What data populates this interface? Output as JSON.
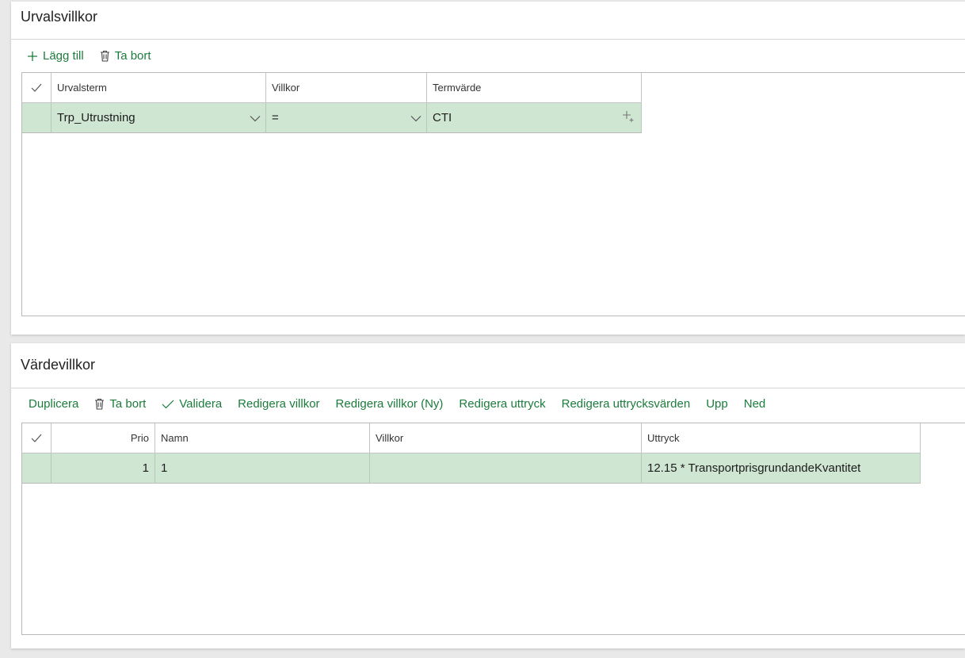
{
  "selection": {
    "title": "Urvalsvillkor",
    "toolbar": {
      "add_label": "Lägg till",
      "delete_label": "Ta bort"
    },
    "grid": {
      "headers": {
        "term": "Urvalsterm",
        "condition": "Villkor",
        "value": "Termvärde"
      },
      "rows": [
        {
          "term": "Trp_Utrustning",
          "condition": "=",
          "value": "CTI"
        }
      ]
    }
  },
  "value_conditions": {
    "title": "Värdevillkor",
    "toolbar": {
      "duplicate_label": "Duplicera",
      "delete_label": "Ta bort",
      "validate_label": "Validera",
      "edit_conditions_label": "Redigera villkor",
      "edit_conditions_new_label": "Redigera villkor (Ny)",
      "edit_expression_label": "Redigera uttryck",
      "edit_expression_values_label": "Redigera uttrycksvärden",
      "up_label": "Upp",
      "down_label": "Ned"
    },
    "grid": {
      "headers": {
        "prio": "Prio",
        "name": "Namn",
        "condition": "Villkor",
        "expression": "Uttryck"
      },
      "rows": [
        {
          "prio": "1",
          "name": "1",
          "condition": "",
          "expression": "12.15 * TransportprisgrundandeKvantitet"
        }
      ]
    }
  },
  "colors": {
    "accent": "#1c7c3c",
    "selected_row": "#cfe6d2",
    "border": "#c4c4c4"
  },
  "icons": [
    "plus-icon",
    "trash-icon",
    "check-icon",
    "chevron-down-icon",
    "add-row-icon"
  ]
}
